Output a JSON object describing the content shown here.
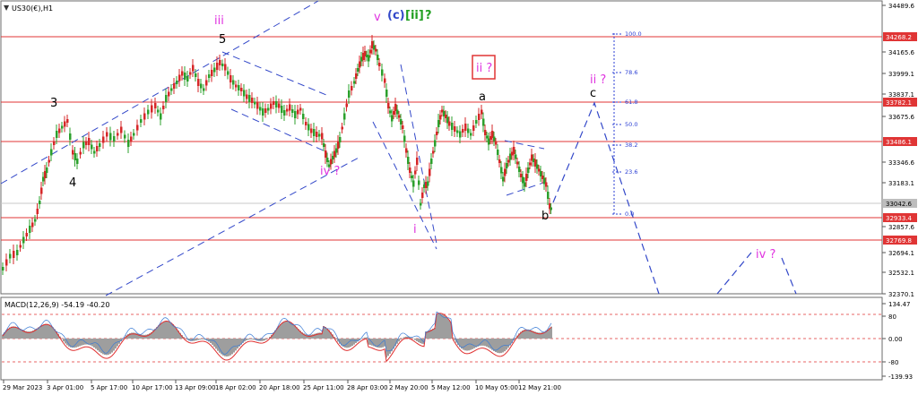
{
  "header": {
    "symbol_label": "US30(€),H1"
  },
  "wave_labels": {
    "iii": "iii",
    "v": "v",
    "c_ii_a": "(c)",
    "c_ii_b": "[ii]",
    "c_ii_c": "?",
    "five": "5",
    "three": "3",
    "four": "4",
    "iv_q": "iv ?",
    "i": "i",
    "ii_box": "ii ?",
    "a": "a",
    "b": "b",
    "c": "c",
    "ii_q": "ii ?",
    "iv_q2": "iv ?"
  },
  "fib_levels": [
    "100.0",
    "78.6",
    "61.8",
    "50.0",
    "38.2",
    "23.6",
    "0.0"
  ],
  "price_axis": {
    "ticks": [
      "34489.6",
      "34165.6",
      "33999.1",
      "33837.1",
      "33675.6",
      "33346.6",
      "33183.1",
      "32857.6",
      "32694.1",
      "32532.1",
      "32370.1"
    ],
    "highlighted": [
      {
        "value": "34268.2",
        "color": "#e03535"
      },
      {
        "value": "33782.1",
        "color": "#e03535"
      },
      {
        "value": "33486.1",
        "color": "#e03535"
      },
      {
        "value": "33042.6",
        "color": "#bdbdbd",
        "text_color": "#000000"
      },
      {
        "value": "32933.4",
        "color": "#e03535"
      },
      {
        "value": "32769.8",
        "color": "#e03535"
      }
    ]
  },
  "macd": {
    "label": "MACD(12,26,9) -54.19 -40.20",
    "axis_ticks": [
      "134.47",
      "80",
      "0.00",
      "-80",
      "-139.93"
    ]
  },
  "time_axis": [
    "29 Mar 2023",
    "3 Apr 01:00",
    "5 Apr 17:00",
    "10 Apr 17:00",
    "13 Apr 09:00",
    "18 Apr 02:00",
    "20 Apr 18:00",
    "25 Apr 11:00",
    "28 Apr 03:00",
    "2 May 20:00",
    "5 May 12:00",
    "10 May 05:00",
    "12 May 21:00"
  ],
  "colors": {
    "bull": "#2ca02c",
    "bear": "#d62728",
    "trend": "#3348c9",
    "resistance": "#e03535",
    "magenta": "#e033e0",
    "green_label": "#22a022",
    "fib": "#2b3fd4",
    "macd_line": "#e03030",
    "macd_hist": "#9e9e9e"
  }
}
